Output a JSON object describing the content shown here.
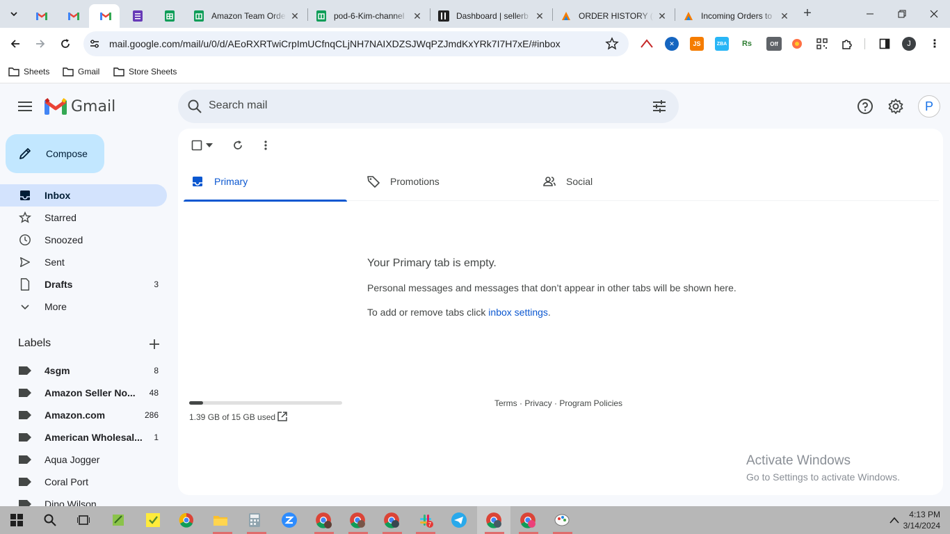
{
  "browser": {
    "tabs": [
      {
        "title": "",
        "favicon": "gmail-icon",
        "active": false
      },
      {
        "title": "",
        "favicon": "gmail-icon",
        "active": false
      },
      {
        "title": "",
        "favicon": "gmail-icon",
        "active": true
      },
      {
        "title": "",
        "favicon": "forms-icon",
        "active": false
      },
      {
        "title": "",
        "favicon": "sheets-icon",
        "active": false
      },
      {
        "title": "Amazon Team Orde",
        "favicon": "sheets-icon",
        "active": false
      },
      {
        "title": "pod-6-Kim-channel",
        "favicon": "sheets-icon",
        "active": false
      },
      {
        "title": "Dashboard | sellerb",
        "favicon": "sellerboard-icon",
        "active": false
      },
      {
        "title": "ORDER HISTORY (JC",
        "favicon": "orange-app-icon",
        "active": false
      },
      {
        "title": "Incoming Orders to",
        "favicon": "orange-app-icon",
        "active": false
      }
    ],
    "url": "mail.google.com/mail/u/0/d/AEoRXRTwiCrpImUCfnqCLjNH7NAIXDZSJWqPZJmdKxYRk7I7H7xE/#inbox",
    "profile_initial": "J",
    "extensions": [
      "extension-logo-icon",
      "extension-blue-icon",
      "JS",
      "ZBA",
      "Rs",
      "Off",
      "extension-orange-icon",
      "extension-qr-icon",
      "puzzle-icon"
    ],
    "bookmarks": [
      "Sheets",
      "Gmail",
      "Store Sheets"
    ]
  },
  "gmail": {
    "app_name": "Gmail",
    "search_placeholder": "Search mail",
    "avatar_initial": "P",
    "compose_label": "Compose",
    "nav": [
      {
        "label": "Inbox",
        "icon": "inbox-icon",
        "count": "",
        "active": true,
        "bold": true
      },
      {
        "label": "Starred",
        "icon": "star-icon",
        "count": "",
        "active": false,
        "bold": false
      },
      {
        "label": "Snoozed",
        "icon": "clock-icon",
        "count": "",
        "active": false,
        "bold": false
      },
      {
        "label": "Sent",
        "icon": "send-icon",
        "count": "",
        "active": false,
        "bold": false
      },
      {
        "label": "Drafts",
        "icon": "draft-icon",
        "count": "3",
        "active": false,
        "bold": true
      },
      {
        "label": "More",
        "icon": "chevron-down-icon",
        "count": "",
        "active": false,
        "bold": false
      }
    ],
    "labels_title": "Labels",
    "labels": [
      {
        "name": "4sgm",
        "count": "8",
        "bold": true
      },
      {
        "name": "Amazon Seller No...",
        "count": "48",
        "bold": true
      },
      {
        "name": "Amazon.com",
        "count": "286",
        "bold": true
      },
      {
        "name": "American Wholesal...",
        "count": "1",
        "bold": true
      },
      {
        "name": "Aqua Jogger",
        "count": "",
        "bold": false
      },
      {
        "name": "Coral Port",
        "count": "",
        "bold": false
      },
      {
        "name": "Dino Wilson",
        "count": "",
        "bold": false
      }
    ],
    "inbox_tabs": [
      {
        "label": "Primary",
        "icon": "inbox-tab-icon",
        "active": true
      },
      {
        "label": "Promotions",
        "icon": "tag-icon",
        "active": false
      },
      {
        "label": "Social",
        "icon": "people-icon",
        "active": false
      }
    ],
    "empty_title": "Your Primary tab is empty.",
    "empty_desc": "Personal messages and messages that don’t appear in other tabs will be shown here.",
    "empty_hint_prefix": "To add or remove tabs click ",
    "empty_hint_link": "inbox settings",
    "empty_hint_suffix": ".",
    "storage_text": "1.39 GB of 15 GB used",
    "storage_fraction": 0.093,
    "footer_links": "Terms · Privacy · Program Policies"
  },
  "watermark": {
    "line1": "Activate Windows",
    "line2": "Go to Settings to activate Windows."
  },
  "taskbar": {
    "time": "4:13 PM",
    "date": "3/14/2024",
    "apps": [
      "windows-start-icon",
      "search-icon",
      "task-view-icon",
      "notepad-plus-icon",
      "sticky-notes-icon",
      "chrome-icon",
      "file-explorer-icon",
      "calculator-icon",
      "zoom-icon",
      "chrome-profile-m-icon",
      "chrome-profile-2-icon",
      "chrome-profile-3-icon",
      "slack-icon",
      "telegram-icon",
      "chrome-profile-j-icon",
      "chrome-profile-4-icon",
      "paint-icon"
    ],
    "slack_badge": "7"
  },
  "colors": {
    "accent": "#0b57d0",
    "compose_bg": "#c2e7ff",
    "active_nav_bg": "#d3e3fd",
    "gmail_red": "#ea4335"
  }
}
